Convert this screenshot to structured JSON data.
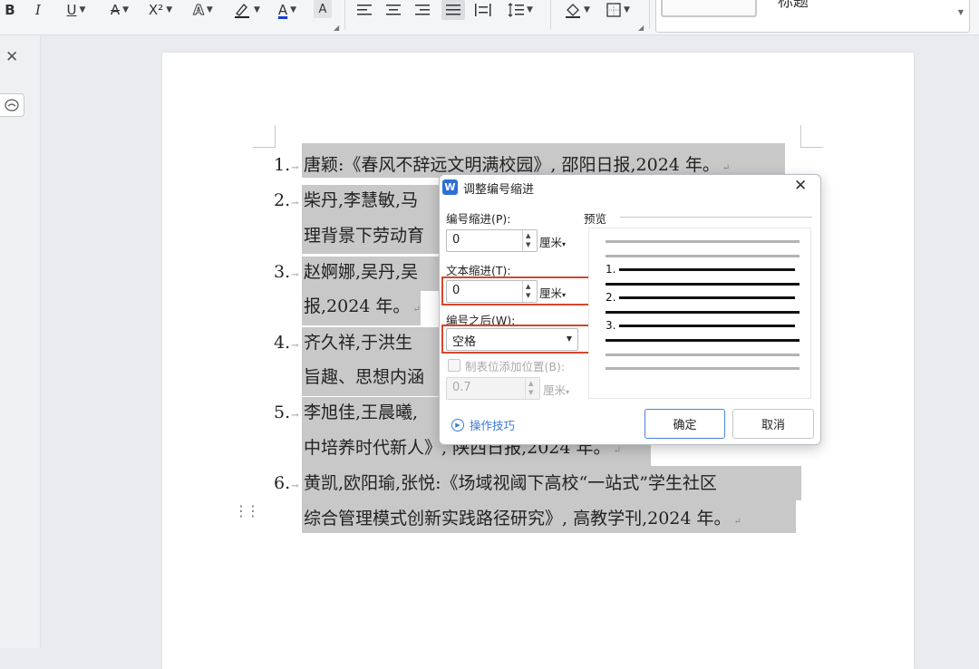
{
  "toolbar": {
    "bold": "B",
    "italic": "I",
    "underline": "U",
    "strikethrough": "A",
    "superscript": "X²",
    "text_effect": "A",
    "highlight_icon": "highlighter-icon",
    "font_color": "A",
    "char_shading": "A",
    "style_preview_text": "标题",
    "colors": {
      "font_color_bar": "#1a3fd6",
      "highlight_bar": "#222222"
    }
  },
  "document": {
    "list_items": [
      {
        "number": "1.",
        "lines": [
          "唐颖:《春风不辞远文明满校园》, 邵阳日报,2024 年。"
        ]
      },
      {
        "number": "2.",
        "lines": [
          "柴丹,李慧敏,马",
          "理背景下劳动育"
        ]
      },
      {
        "number": "3.",
        "lines": [
          "赵婀娜,吴丹,吴",
          "报,2024 年。"
        ]
      },
      {
        "number": "4.",
        "lines": [
          "齐久祥,于洪生",
          "旨趣、思想内涵"
        ]
      },
      {
        "number": "5.",
        "lines": [
          "李旭佳,王晨曦,",
          "中培养时代新人》, 陕西日报,2024 年。"
        ]
      },
      {
        "number": "6.",
        "lines": [
          "黄凯,欧阳瑜,张悦:《场域视阈下高校“一站式”学生社区",
          "综合管理模式创新实践路径研究》, 高教学刊,2024 年。"
        ]
      }
    ]
  },
  "dialog": {
    "title": "调整编号缩进",
    "number_indent_label": "编号缩进(P):",
    "number_indent_value": "0",
    "text_indent_label": "文本缩进(T):",
    "text_indent_value": "0",
    "unit": "厘米",
    "after_number_label": "编号之后(W):",
    "after_number_value": "空格",
    "tab_stop_label": "制表位添加位置(B):",
    "tab_stop_value": "0.7",
    "preview_label": "预览",
    "preview_numbers": [
      "1.",
      "2.",
      "3."
    ],
    "tips_label": "操作技巧",
    "ok_label": "确定",
    "cancel_label": "取消",
    "highlight_color": "#d4472e"
  }
}
